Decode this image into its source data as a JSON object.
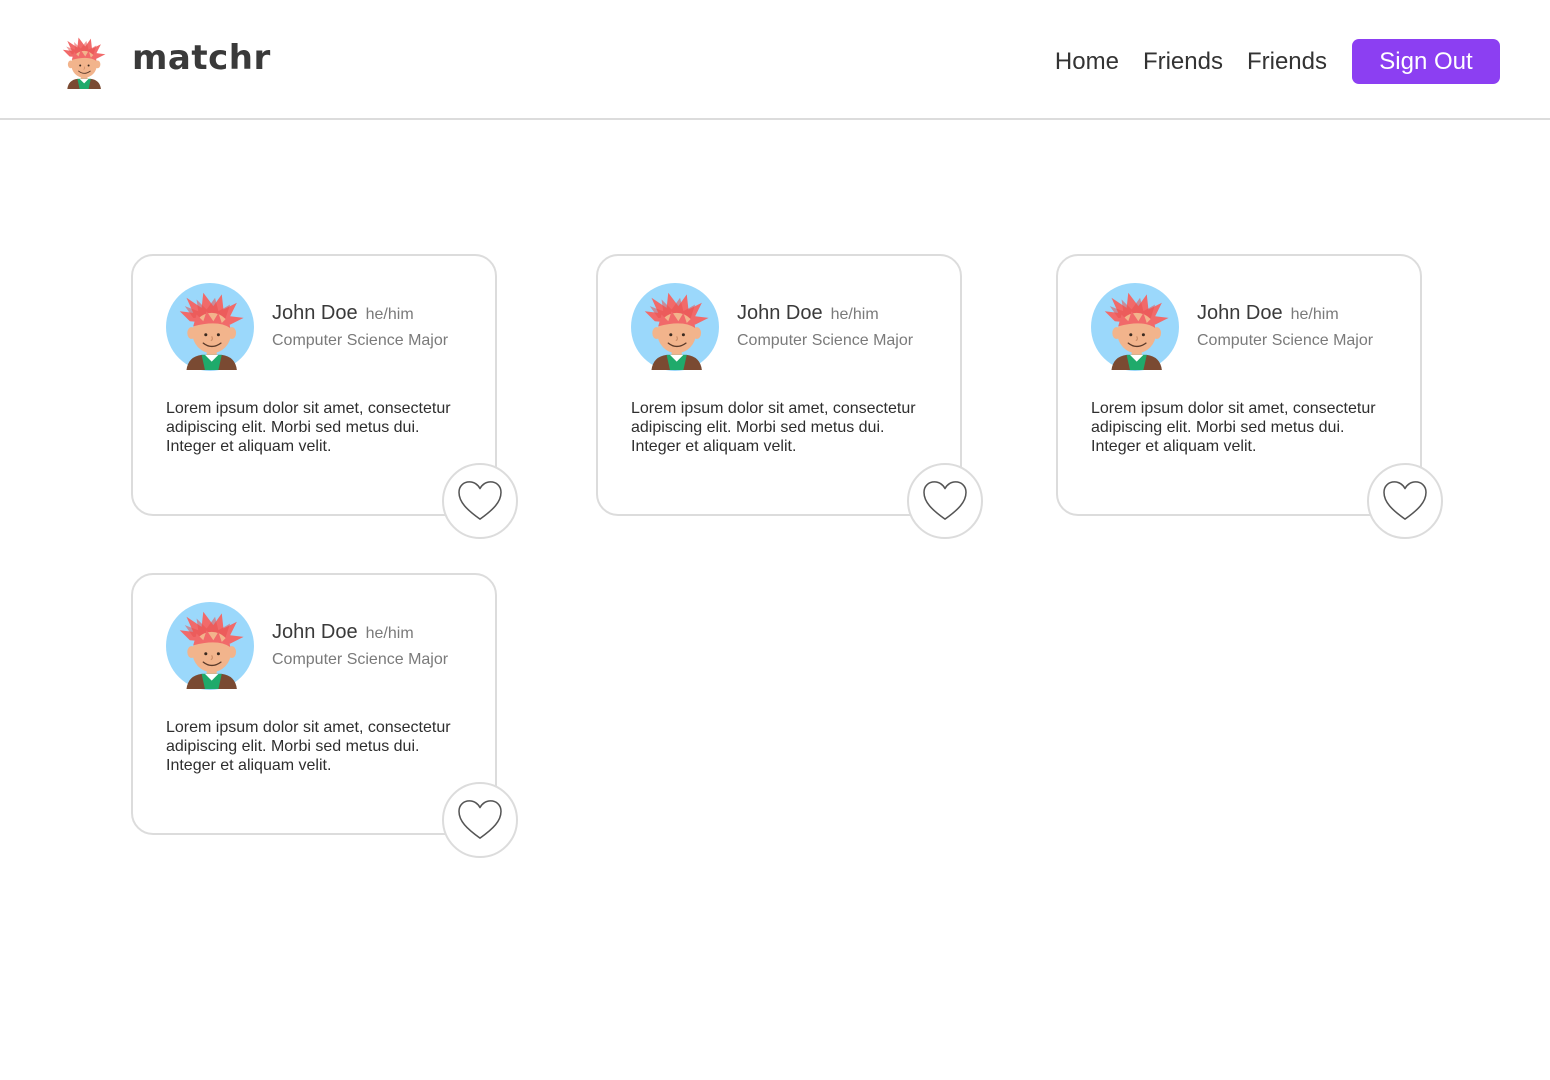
{
  "app": {
    "brand": "matchr"
  },
  "nav": {
    "items": [
      {
        "label": "Home"
      },
      {
        "label": "Friends"
      },
      {
        "label": "Friends"
      }
    ],
    "signout_label": "Sign Out"
  },
  "colors": {
    "accent": "#8c3ff2",
    "border": "#dcdcdc",
    "avatar_bg": "#9bd8fb",
    "hair": "#f16a6a",
    "skin": "#f2b48c"
  },
  "cards": [
    {
      "name": "John Doe",
      "pronouns": "he/him",
      "major": "Computer Science Major",
      "bio": "Lorem ipsum dolor sit amet, consectetur adipiscing elit. Morbi sed metus dui. Integer et aliquam velit.",
      "avatar_icon": "avatar-cartoon-boy",
      "like_icon": "heart-outline-icon"
    },
    {
      "name": "John Doe",
      "pronouns": "he/him",
      "major": "Computer Science Major",
      "bio": "Lorem ipsum dolor sit amet, consectetur adipiscing elit. Morbi sed metus dui. Integer et aliquam velit.",
      "avatar_icon": "avatar-cartoon-boy",
      "like_icon": "heart-outline-icon"
    },
    {
      "name": "John Doe",
      "pronouns": "he/him",
      "major": "Computer Science Major",
      "bio": "Lorem ipsum dolor sit amet, consectetur adipiscing elit. Morbi sed metus dui. Integer et aliquam velit.",
      "avatar_icon": "avatar-cartoon-boy",
      "like_icon": "heart-outline-icon"
    },
    {
      "name": "John Doe",
      "pronouns": "he/him",
      "major": "Computer Science Major",
      "bio": "Lorem ipsum dolor sit amet, consectetur adipiscing elit. Morbi sed metus dui. Integer et aliquam velit.",
      "avatar_icon": "avatar-cartoon-boy",
      "like_icon": "heart-outline-icon"
    }
  ]
}
